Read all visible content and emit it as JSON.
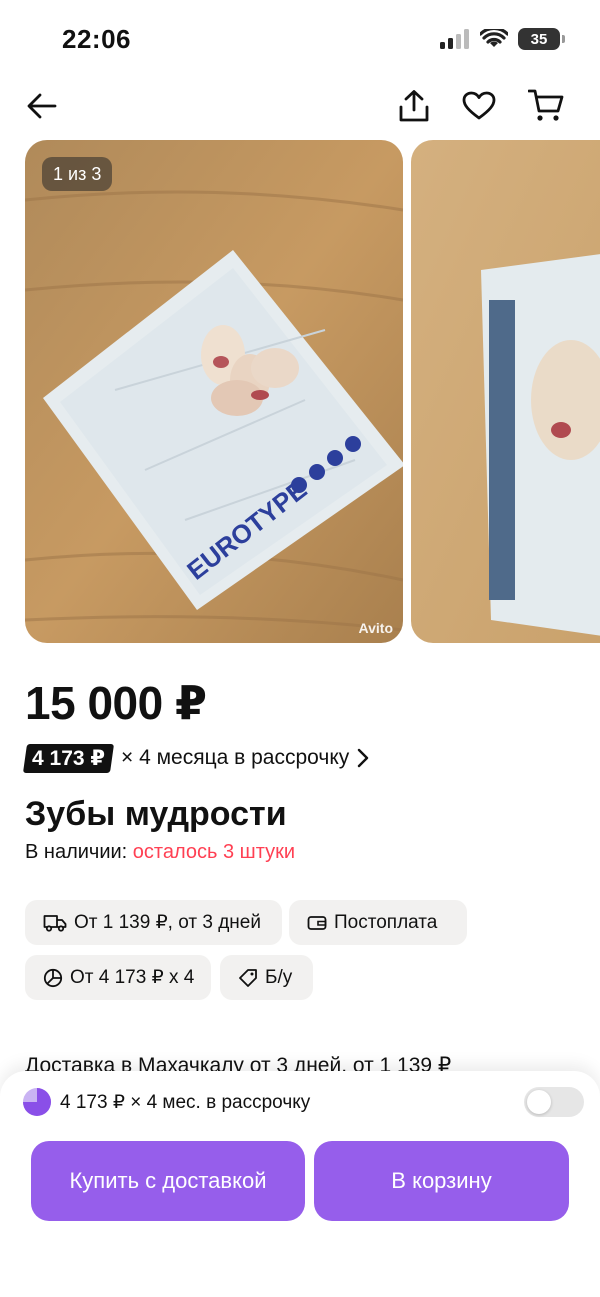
{
  "status_bar": {
    "time": "22:06",
    "battery": "35"
  },
  "gallery": {
    "counter": "1 из 3",
    "watermark": "Avito",
    "package_brand": "EUROTYPE"
  },
  "product": {
    "price": "15 000 ₽",
    "installment_badge": "4 173 ₽",
    "installment_text": "× 4 месяца в рассрочку",
    "title": "Зубы мудрости",
    "availability_label": "В наличии:",
    "availability_left": "осталось 3 штуки"
  },
  "chips": {
    "delivery": "От 1 139 ₽, от 3 дней",
    "postpay": "Постоплата",
    "installment": "От 4 173 ₽ x 4",
    "condition": "Б/у"
  },
  "delivery_line": "Доставка в Махачкалу от 3 дней, от 1 139 ₽",
  "bottom_sheet": {
    "installment_toggle_label": "4 173 ₽ × 4 мес. в рассрочку",
    "buy_button": "Купить с доставкой",
    "cart_button": "В корзину"
  },
  "colors": {
    "accent": "#965eeb",
    "alert": "#ff4053",
    "chip_bg": "#f2f1f0"
  },
  "icons": [
    "back-arrow-icon",
    "share-icon",
    "heart-icon",
    "cart-icon",
    "truck-icon",
    "wallet-icon",
    "pie-chart-icon",
    "tag-icon",
    "chevron-right-icon"
  ]
}
